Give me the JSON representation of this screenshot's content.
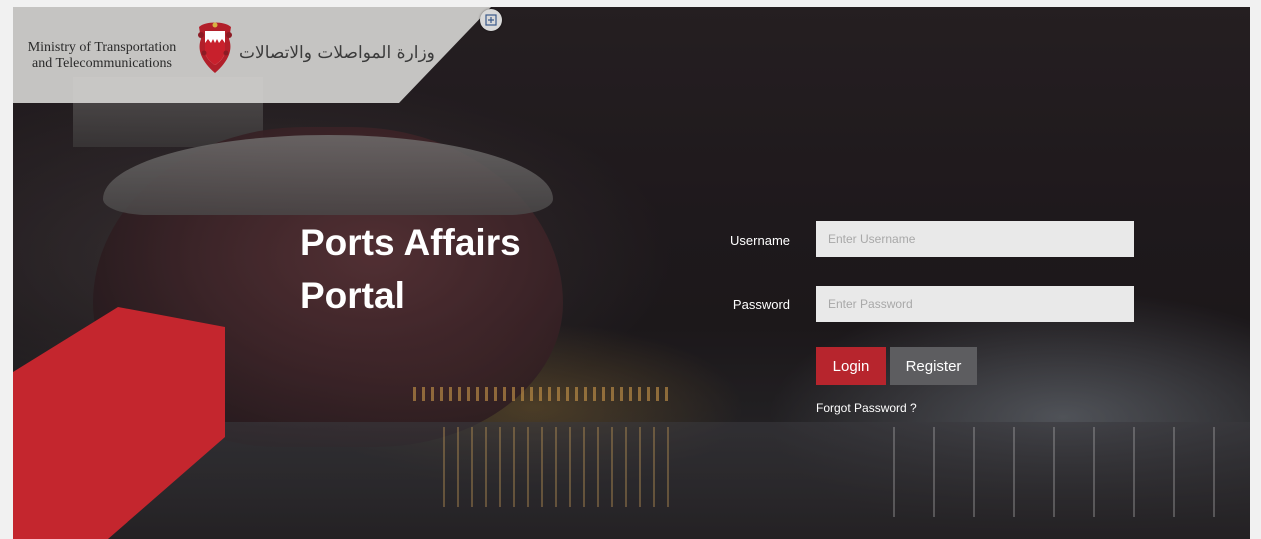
{
  "header": {
    "org_name_en": "Ministry of Transportation and Telecommunications",
    "org_name_ar": "وزارة المواصلات والاتصالات"
  },
  "main": {
    "title_line1": "Ports Affairs",
    "title_line2": "Portal"
  },
  "login_form": {
    "username_label": "Username",
    "username_placeholder": "Enter Username",
    "username_value": "",
    "password_label": "Password",
    "password_placeholder": "Enter Password",
    "password_value": "",
    "login_button": "Login",
    "register_button": "Register",
    "forgot_link": "Forgot Password ?"
  },
  "icons": {
    "expand": "expand-icon",
    "emblem": "bahrain-emblem-icon"
  },
  "colors": {
    "accent_red": "#c4262e",
    "login_button": "#b7252d",
    "register_button": "#5d5d60",
    "input_bg": "#e9e9e9"
  }
}
